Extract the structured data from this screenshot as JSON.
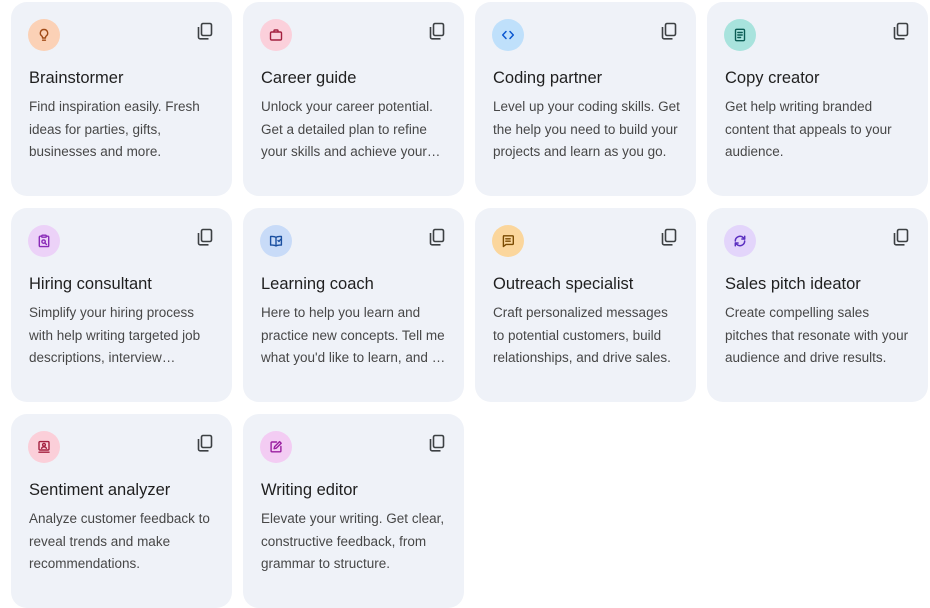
{
  "cards": [
    {
      "title": "Brainstormer",
      "description": "Find inspiration easily. Fresh ideas for parties, gifts, businesses and more.",
      "icon": "lightbulb-icon",
      "icon_bg": "#fbd1b6",
      "icon_color": "#a04a16"
    },
    {
      "title": "Career guide",
      "description": "Unlock your career potential. Get a detailed plan to refine your skills and achieve your career goals.",
      "icon": "briefcase-icon",
      "icon_bg": "#fbd0db",
      "icon_color": "#a3203f"
    },
    {
      "title": "Coding partner",
      "description": "Level up your coding skills. Get the help you need to build your projects and learn as you go.",
      "icon": "code-icon",
      "icon_bg": "#bfe0fb",
      "icon_color": "#0b57d0"
    },
    {
      "title": "Copy creator",
      "description": "Get help writing branded content that appeals to your audience.",
      "icon": "document-icon",
      "icon_bg": "#a8e3dd",
      "icon_color": "#0a5c54"
    },
    {
      "title": "Hiring consultant",
      "description": "Simplify your hiring process with help writing targeted job descriptions, interview questions and more.",
      "icon": "clipboard-search-icon",
      "icon_bg": "#ecd2f8",
      "icon_color": "#8a2bb8"
    },
    {
      "title": "Learning coach",
      "description": "Here to help you learn and practice new concepts. Tell me what you'd like to learn, and I'll help you get started.",
      "icon": "book-icon",
      "icon_bg": "#c8dbf8",
      "icon_color": "#1a4fa0"
    },
    {
      "title": "Outreach specialist",
      "description": "Craft personalized messages to potential customers, build relationships, and drive sales.",
      "icon": "message-icon",
      "icon_bg": "#fbd69c",
      "icon_color": "#7a4a00"
    },
    {
      "title": "Sales pitch ideator",
      "description": "Create compelling sales pitches that resonate with your audience and drive results.",
      "icon": "cycle-arrows-icon",
      "icon_bg": "#e3d5fb",
      "icon_color": "#5b2fc0"
    },
    {
      "title": "Sentiment analyzer",
      "description": "Analyze customer feedback to reveal trends and make recommendations.",
      "icon": "feedback-icon",
      "icon_bg": "#fbcfd9",
      "icon_color": "#a3203f"
    },
    {
      "title": "Writing editor",
      "description": "Elevate your writing. Get clear, constructive feedback, from grammar to structure.",
      "icon": "edit-icon",
      "icon_bg": "#f3ccf3",
      "icon_color": "#9a1fa0"
    }
  ]
}
